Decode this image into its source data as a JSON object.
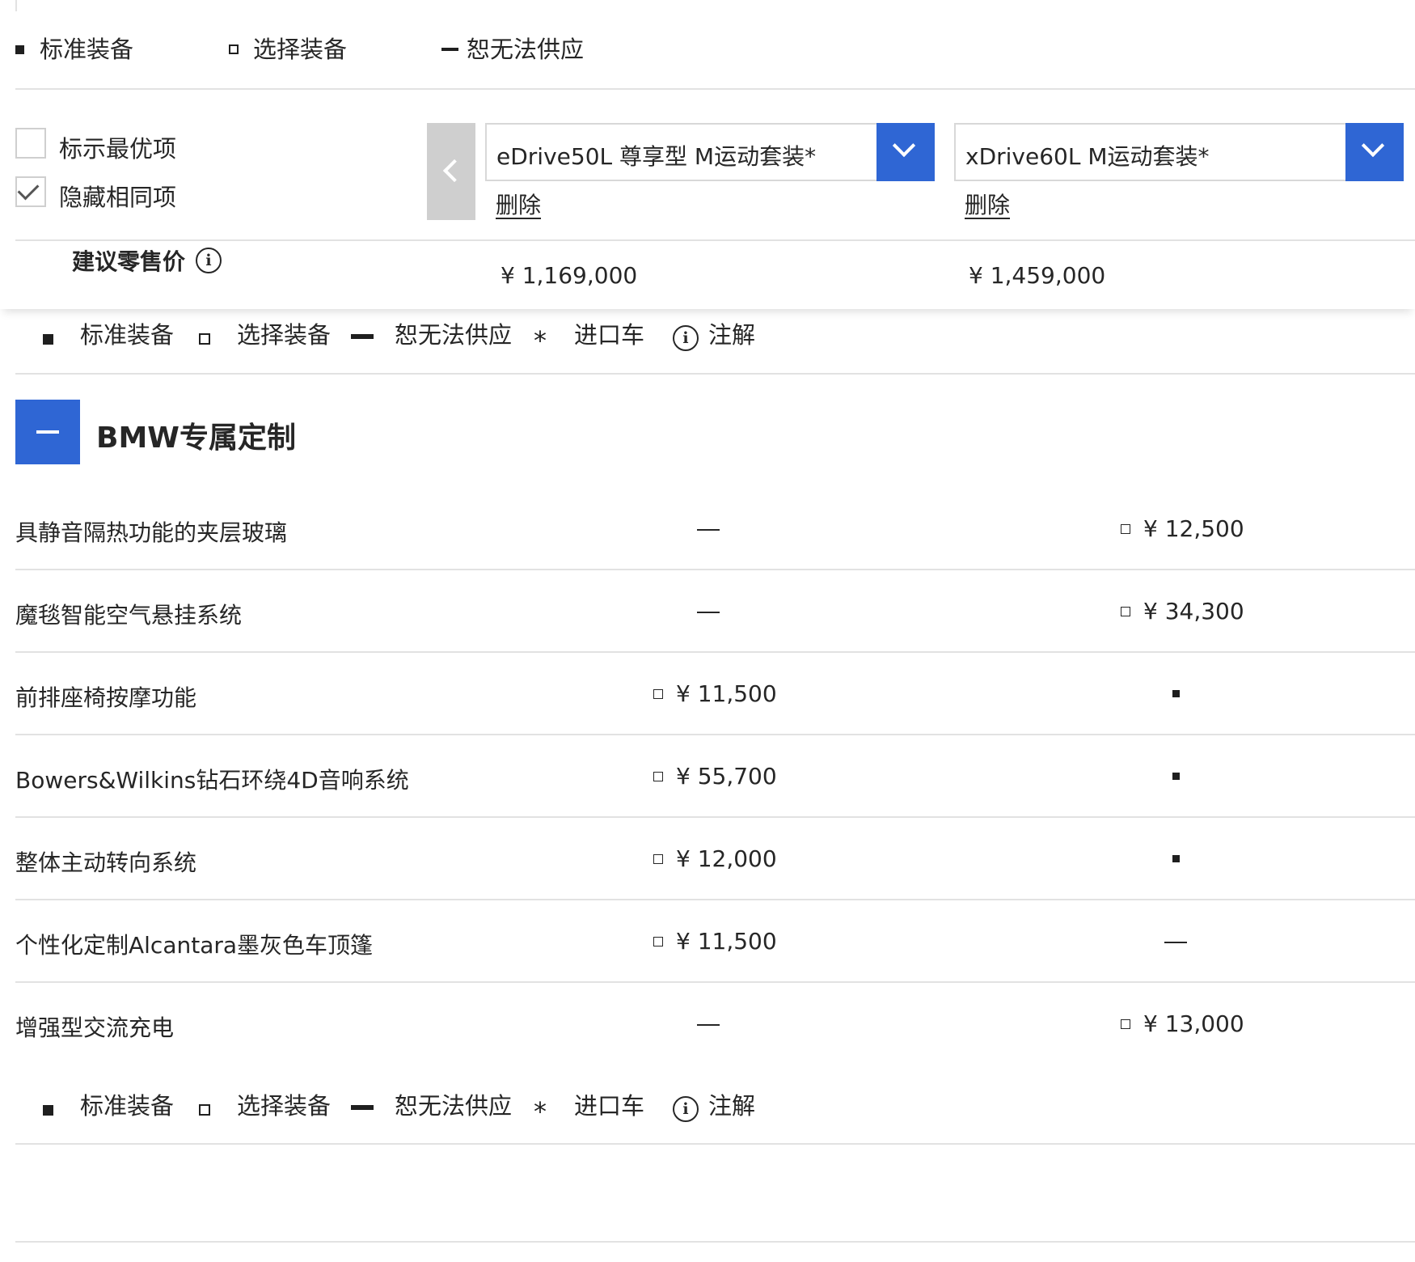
{
  "sticky_header": {
    "legend": {
      "standard": "标准装备",
      "optional": "选择装备",
      "unavailable": "恕无法供应"
    },
    "options": {
      "highlight_best": {
        "label": "标示最优项",
        "checked": false
      },
      "hide_same": {
        "label": "隐藏相同项",
        "checked": true
      }
    },
    "models": [
      {
        "name": "eDrive50L 尊享型 M运动套装*",
        "delete_label": "删除",
        "price": "¥ 1,169,000"
      },
      {
        "name": "xDrive60L M运动套装*",
        "delete_label": "删除",
        "price": "¥ 1,459,000"
      }
    ],
    "price_label": "建议零售价",
    "info_glyph": "i"
  },
  "legend_full": {
    "standard": "标准装备",
    "optional": "选择装备",
    "unavailable": "恕无法供应",
    "imported": "进口车",
    "note": "注解",
    "star_glyph": "*",
    "info_glyph": "i"
  },
  "section": {
    "title": "BMW专属定制",
    "toggle_state": "expanded",
    "rows": [
      {
        "label": "具静音隔热功能的夹层玻璃",
        "model1": {
          "type": "unavailable"
        },
        "model2": {
          "type": "optional",
          "price": "¥ 12,500"
        }
      },
      {
        "label": "魔毯智能空气悬挂系统",
        "model1": {
          "type": "unavailable"
        },
        "model2": {
          "type": "optional",
          "price": "¥ 34,300"
        }
      },
      {
        "label": "前排座椅按摩功能",
        "model1": {
          "type": "optional",
          "price": "¥ 11,500"
        },
        "model2": {
          "type": "standard"
        }
      },
      {
        "label": "Bowers&Wilkins钻石环绕4D音响系统",
        "model1": {
          "type": "optional",
          "price": "¥ 55,700"
        },
        "model2": {
          "type": "standard"
        }
      },
      {
        "label": "整体主动转向系统",
        "model1": {
          "type": "optional",
          "price": "¥ 12,000"
        },
        "model2": {
          "type": "standard"
        }
      },
      {
        "label": "个性化定制Alcantara墨灰色车顶篷",
        "model1": {
          "type": "optional",
          "price": "¥ 11,500"
        },
        "model2": {
          "type": "unavailable"
        }
      },
      {
        "label": "增强型交流充电",
        "model1": {
          "type": "unavailable"
        },
        "model2": {
          "type": "optional",
          "price": "¥ 13,000"
        }
      }
    ]
  },
  "colors": {
    "accent_blue": "#2f66d4",
    "text": "#262626",
    "divider": "#e2e2e2"
  }
}
